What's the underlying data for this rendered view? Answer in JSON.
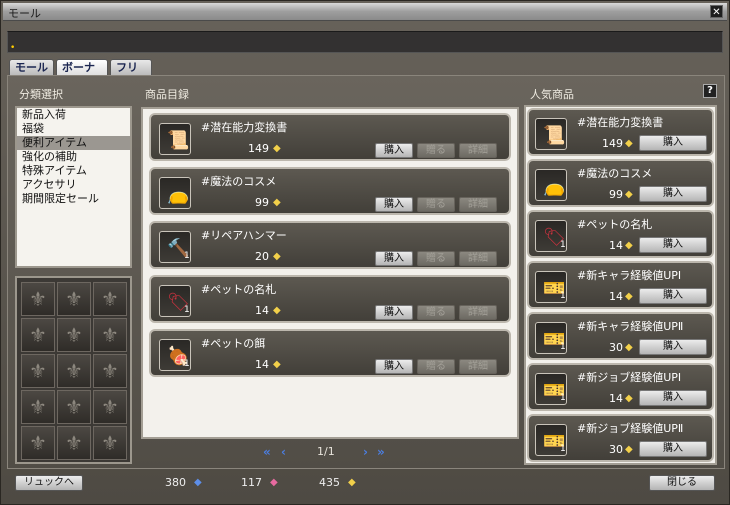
{
  "window": {
    "title": "モール",
    "close": "✕"
  },
  "tabs": [
    "モール",
    "ボーナス",
    "フリー"
  ],
  "sections": {
    "category": "分類選択",
    "list": "商品目録",
    "popular": "人気商品",
    "help": "?"
  },
  "categories": [
    "新品入荷",
    "福袋",
    "便利アイテム",
    "強化の補助",
    "特殊アイテム",
    "アクセサリ",
    "期間限定セール"
  ],
  "selected_category": "便利アイテム",
  "buttons": {
    "buy": "購入",
    "gift": "贈る",
    "detail": "詳細"
  },
  "items": [
    {
      "name": "#潜在能力変換書",
      "price": "149",
      "qty": ""
    },
    {
      "name": "#魔法のコスメ",
      "price": "99",
      "qty": ""
    },
    {
      "name": "#リペアハンマー",
      "price": "20",
      "qty": "1"
    },
    {
      "name": "#ペットの名札",
      "price": "14",
      "qty": "1"
    },
    {
      "name": "#ペットの餌",
      "price": "14",
      "qty": "1"
    }
  ],
  "pager": {
    "text": "1/1"
  },
  "popular": [
    {
      "name": "#潜在能力変換書",
      "price": "149",
      "qty": ""
    },
    {
      "name": "#魔法のコスメ",
      "price": "99",
      "qty": ""
    },
    {
      "name": "#ペットの名札",
      "price": "14",
      "qty": "1"
    },
    {
      "name": "#新キャラ経験値UPⅠ",
      "price": "14",
      "qty": "1"
    },
    {
      "name": "#新キャラ経験値UPⅡ",
      "price": "30",
      "qty": "1"
    },
    {
      "name": "#新ジョブ経験値UPⅠ",
      "price": "14",
      "qty": "1"
    },
    {
      "name": "#新ジョブ経験値UPⅡ",
      "price": "30",
      "qty": "1"
    }
  ],
  "footer": {
    "left_button": "リュックへ",
    "right_button": "閉じる",
    "currency_blue": "380",
    "currency_pink": "117",
    "currency_gold": "435"
  },
  "colors": {
    "gem_gold": "#f2d04a",
    "gem_blue": "#5d8ee8",
    "gem_pink": "#e86aa0"
  }
}
